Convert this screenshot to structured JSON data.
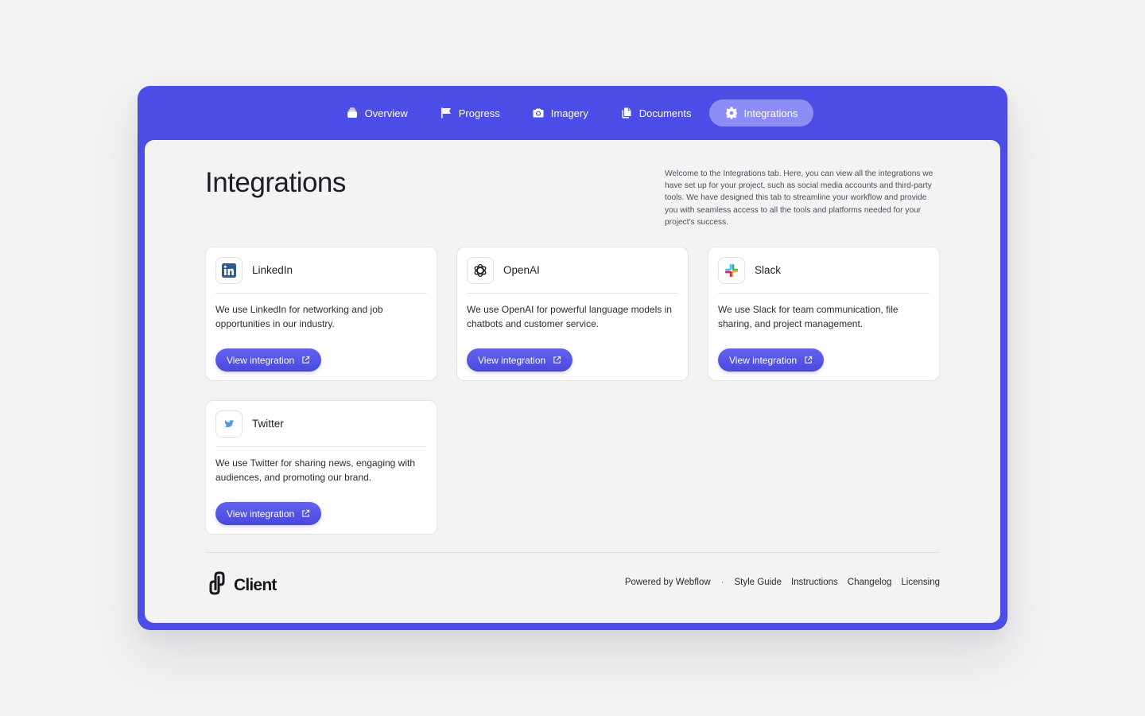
{
  "nav": {
    "tabs": [
      {
        "label": "Overview",
        "icon": "layers-icon"
      },
      {
        "label": "Progress",
        "icon": "flag-icon"
      },
      {
        "label": "Imagery",
        "icon": "camera-icon"
      },
      {
        "label": "Documents",
        "icon": "documents-icon"
      },
      {
        "label": "Integrations",
        "icon": "gear-icon",
        "active": true
      }
    ]
  },
  "page": {
    "title": "Integrations",
    "intro": "Welcome to the Integrations tab. Here, you can view all the integrations we have set up for your project, such as social media accounts and third-party tools. We have designed this tab to streamline your workflow and provide you with seamless access to all the tools and platforms needed for your project's success."
  },
  "cards": [
    {
      "name": "LinkedIn",
      "icon": "linkedin-icon",
      "description": "We use LinkedIn for networking and job opportunities in our industry.",
      "button": "View integration"
    },
    {
      "name": "OpenAI",
      "icon": "openai-icon",
      "description": "We use OpenAI for powerful language models in chatbots and customer service.",
      "button": "View integration"
    },
    {
      "name": "Slack",
      "icon": "slack-icon",
      "description": "We use Slack for team communication, file sharing, and project management.",
      "button": "View integration"
    },
    {
      "name": "Twitter",
      "icon": "twitter-icon",
      "description": "We use Twitter for sharing news, engaging with audiences, and promoting our brand.",
      "button": "View integration"
    }
  ],
  "footer": {
    "brand": "Client",
    "powered_by": "Powered by Webflow",
    "separator": "·",
    "links": [
      "Style Guide",
      "Instructions",
      "Changelog",
      "Licensing"
    ]
  },
  "colors": {
    "frame": "#4c4ce6",
    "active_tab": "#8d8ef5",
    "button": "#5454e6",
    "background": "#f2f2f3"
  }
}
